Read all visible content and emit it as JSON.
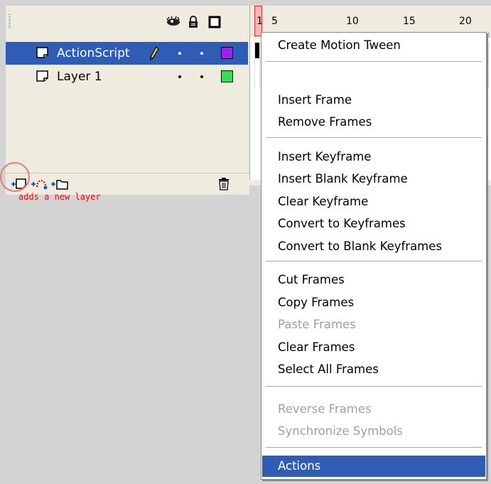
{
  "timeline": {
    "header_icons": [
      "eye-icon",
      "lock-icon",
      "outline-icon"
    ],
    "ruler": {
      "labels": [
        "1",
        "5",
        "10",
        "15",
        "20"
      ]
    },
    "layers": [
      {
        "name": "ActionScript",
        "selected": true,
        "color": "#a020f0"
      },
      {
        "name": "Layer 1",
        "selected": false,
        "color": "#33dd55"
      }
    ],
    "bottom_icons": [
      "insert-layer-icon",
      "add-motion-guide-icon",
      "insert-layer-folder-icon",
      "delete-layer-icon"
    ]
  },
  "annotation": {
    "caption": "adds a new layer",
    "color": "#e01010"
  },
  "context_menu": {
    "groups": [
      [
        {
          "label": "Create Motion Tween",
          "enabled": true
        }
      ],
      [
        {
          "label": "Insert Frame",
          "enabled": true
        },
        {
          "label": "Remove Frames",
          "enabled": true
        }
      ],
      [
        {
          "label": "Insert Keyframe",
          "enabled": true
        },
        {
          "label": "Insert Blank Keyframe",
          "enabled": true
        },
        {
          "label": "Clear Keyframe",
          "enabled": true
        },
        {
          "label": "Convert to Keyframes",
          "enabled": true
        },
        {
          "label": "Convert to Blank Keyframes",
          "enabled": true
        }
      ],
      [
        {
          "label": "Cut Frames",
          "enabled": true
        },
        {
          "label": "Copy Frames",
          "enabled": true
        },
        {
          "label": "Paste Frames",
          "enabled": false
        },
        {
          "label": "Clear Frames",
          "enabled": true
        },
        {
          "label": "Select All Frames",
          "enabled": true
        }
      ],
      [
        {
          "label": "Reverse Frames",
          "enabled": false
        },
        {
          "label": "Synchronize Symbols",
          "enabled": false
        }
      ],
      [
        {
          "label": "Actions",
          "enabled": true,
          "highlighted": true
        }
      ]
    ]
  },
  "colors": {
    "selection": "#2f5db6",
    "panel": "#efebde",
    "stage_bg": "#d3d3d3",
    "highlight_circle": "#e87a7a"
  }
}
